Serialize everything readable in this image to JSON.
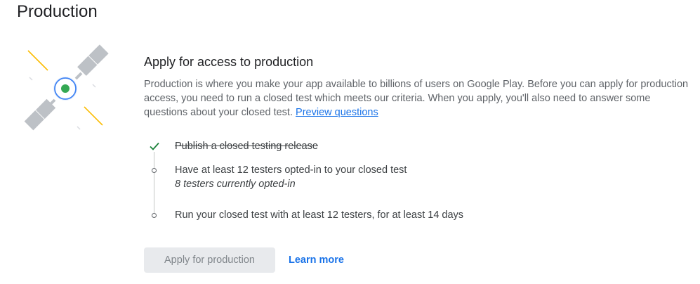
{
  "page": {
    "title": "Production"
  },
  "section": {
    "title": "Apply for access to production",
    "description": "Production is where you make your app available to billions of users on Google Play. Before you can apply for production access, you need to run a closed test which meets our criteria. When you apply, you'll also need to answer some questions about your closed test.",
    "preview_link": "Preview questions"
  },
  "steps": [
    {
      "label": "Publish a closed testing release",
      "status": "complete",
      "icon": "check-icon"
    },
    {
      "label": "Have at least 12 testers opted-in to your closed test",
      "detail": "8 testers currently opted-in",
      "status": "pending",
      "icon": "circle-icon"
    },
    {
      "label": "Run your closed test with at least 12 testers, for at least 14 days",
      "status": "pending",
      "icon": "circle-icon"
    }
  ],
  "actions": {
    "apply_label": "Apply for production",
    "apply_disabled": true,
    "learn_more_label": "Learn more"
  },
  "colors": {
    "accent": "#1a73e8",
    "success": "#188038",
    "disabled_bg": "#e8eaed",
    "satellite_core": "#34a853",
    "satellite_ring": "#4285f4",
    "ray": "#fbbc04"
  }
}
